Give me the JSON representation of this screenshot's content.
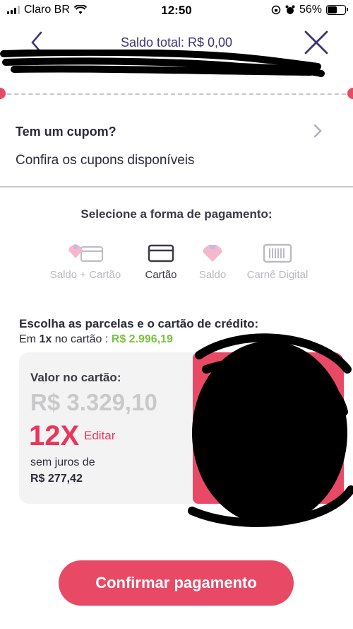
{
  "status_bar": {
    "carrier": "Claro BR",
    "time": "12:50",
    "battery": "56%"
  },
  "header": {
    "title": "Saldo total: R$ 0,00"
  },
  "coupon": {
    "title": "Tem um cupom?",
    "subtitle": "Confira os cupons disponíveis"
  },
  "payment": {
    "title": "Selecione a forma de pagamento:",
    "methods": [
      {
        "label": "Saldo + Cartão",
        "icon": "diamond-card-icon",
        "active": false
      },
      {
        "label": "Cartão",
        "icon": "credit-card-icon",
        "active": true
      },
      {
        "label": "Saldo",
        "icon": "diamond-icon",
        "active": false
      },
      {
        "label": "Carnê Digital",
        "icon": "barcode-icon",
        "active": false
      }
    ]
  },
  "installments": {
    "title": "Escolha as parcelas e o cartão de crédito:",
    "sub_prefix": "Em",
    "sub_count": "1x",
    "sub_middle": "no cartão :",
    "sub_value": "R$ 2.996,19"
  },
  "card_summary": {
    "label": "Valor no cartão:",
    "value": "R$ 3.329,10",
    "installments": "12X",
    "edit": "Editar",
    "no_interest": "sem juros de",
    "installment_amount": "R$ 277,42"
  },
  "confirm_label": "Confirmar pagamento",
  "colors": {
    "accent": "#e84a66",
    "green": "#7dc243",
    "header_text": "#3d3570"
  }
}
